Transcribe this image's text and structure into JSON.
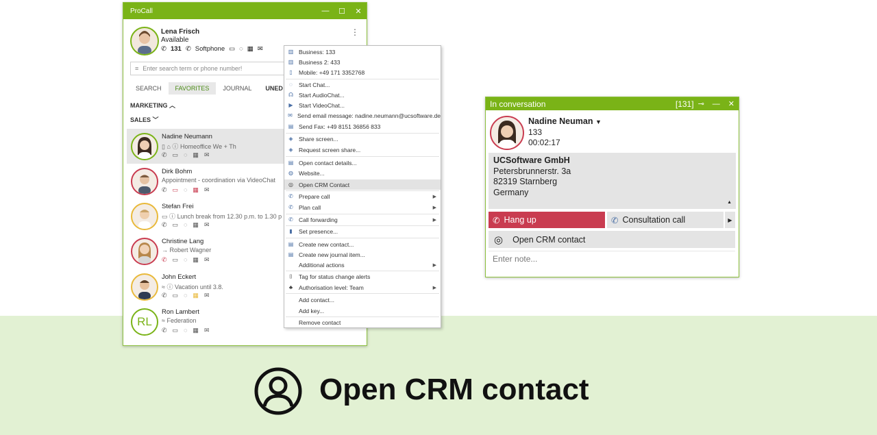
{
  "procall": {
    "title": "ProCall",
    "user": {
      "name": "Lena Frisch",
      "status": "Available",
      "ext": "131",
      "device": "Softphone"
    },
    "search_placeholder": "Enter search term or phone number!",
    "tabs": [
      "SEARCH",
      "FAVORITES",
      "JOURNAL",
      "UNED"
    ],
    "groups": {
      "marketing": "MARKETING",
      "sales": "SALES"
    },
    "contacts": [
      {
        "name": "Nadine Neumann",
        "sub": "Homeoffice We + Th"
      },
      {
        "name": "Dirk Bohm",
        "sub": "Appointment - coordination via VideoChat"
      },
      {
        "name": "Stefan Frei",
        "sub": "Lunch break from 12.30 p.m. to 1.30 p"
      },
      {
        "name": "Christine Lang",
        "sub": "→ Robert Wagner"
      },
      {
        "name": "John Eckert",
        "sub": "Vacation until 3.8."
      },
      {
        "name": "Ron Lambert",
        "sub": "Federation",
        "initials": "RL"
      }
    ]
  },
  "menu": {
    "items": [
      "Business: 133",
      "Business 2: 433",
      "Mobile: +49 171 3352768",
      "Start Chat...",
      "Start AudioChat...",
      "Start VideoChat...",
      "Send email message: nadine.neumann@ucsoftware.de",
      "Send Fax: +49 8151 36856 833",
      "Share screen...",
      "Request screen share...",
      "Open contact details...",
      "Website...",
      "Open CRM Contact",
      "Prepare call",
      "Plan call",
      "Call forwarding",
      "Set presence...",
      "Create new contact...",
      "Create new journal item...",
      "Additional actions",
      "Tag for status change alerts",
      "Authorisation level: Team",
      "Add contact...",
      "Add key...",
      "Remove contact"
    ]
  },
  "conversation": {
    "title": "In conversation",
    "line": "[131]",
    "name": "Nadine Neuman",
    "number": "133",
    "duration": "00:02:17",
    "company": "UCSoftware GmbH",
    "street": "Petersbrunnerstr. 3a",
    "city": "82319 Starnberg",
    "country": "Germany",
    "hangup_label": "Hang up",
    "consult_label": "Consultation call",
    "crm_label": "Open CRM contact",
    "note_placeholder": "Enter note..."
  },
  "caption": "Open CRM contact",
  "colors": {
    "brand_green": "#7ab317",
    "hangup_red": "#c93c50",
    "band": "#e2f1d3"
  }
}
